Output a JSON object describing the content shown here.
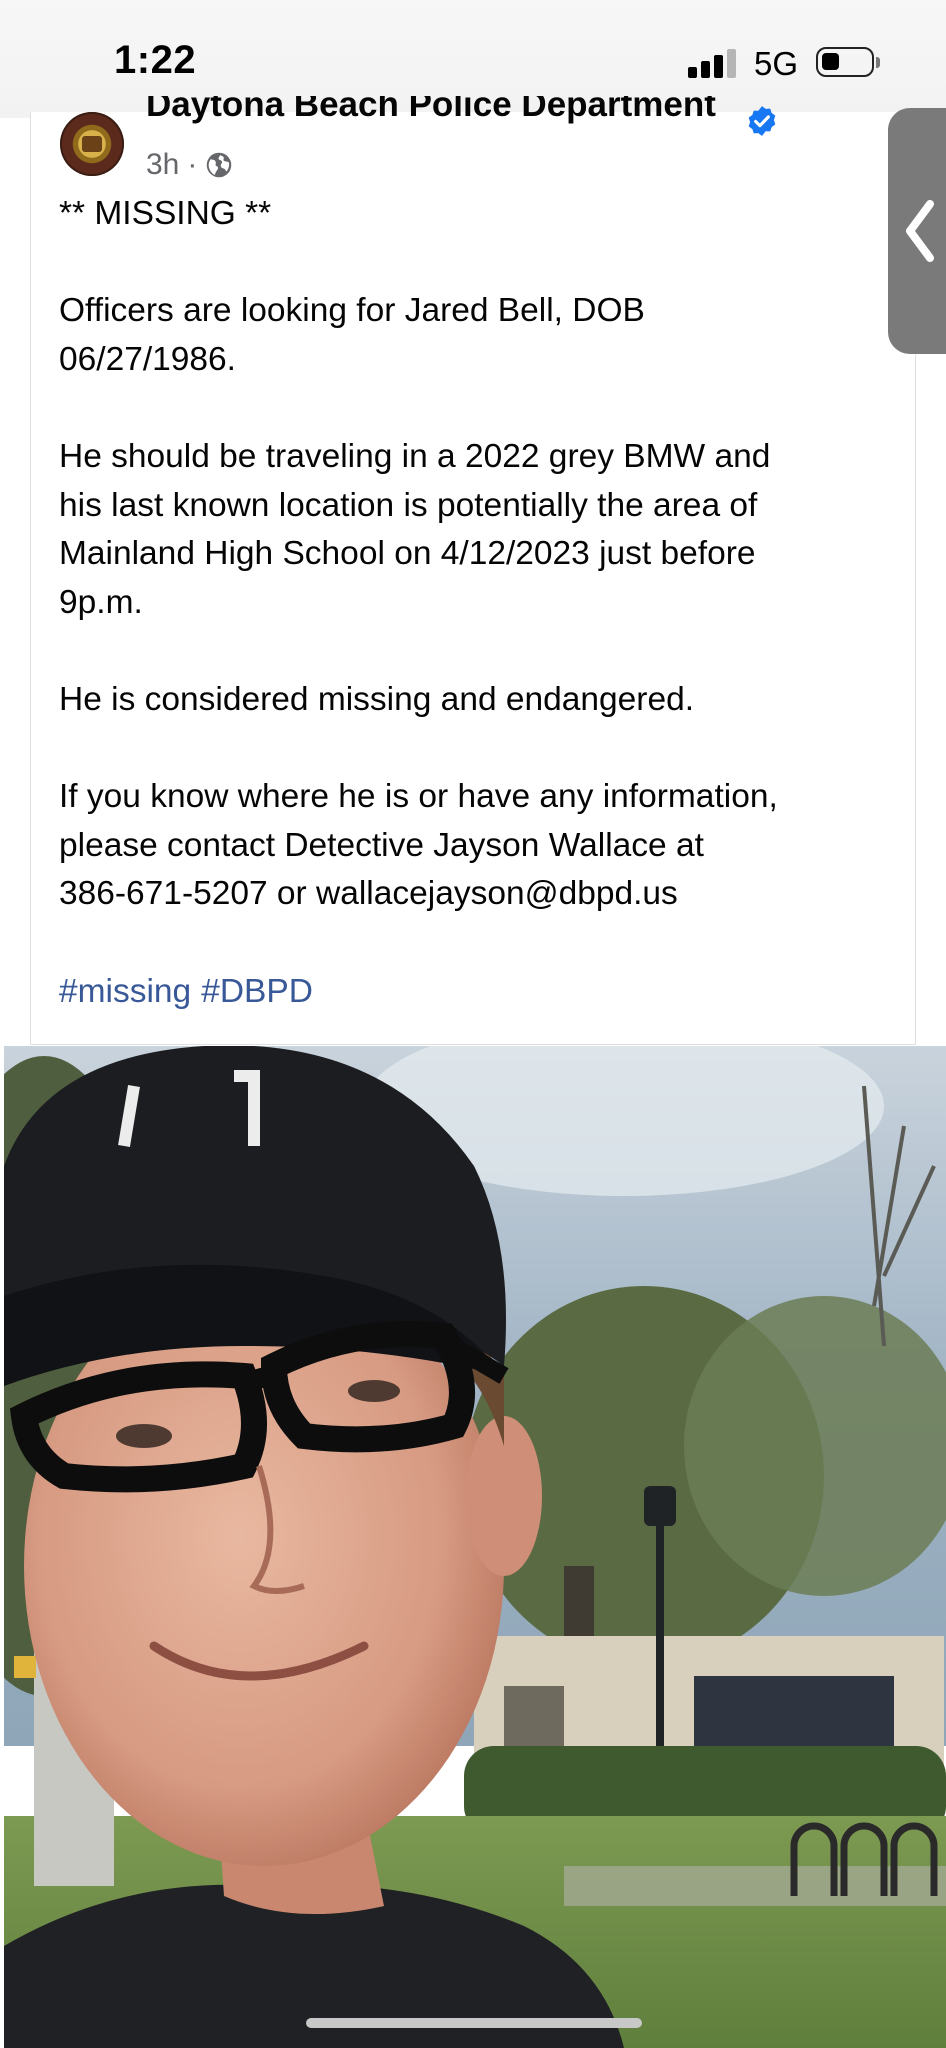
{
  "status_bar": {
    "time": "1:22",
    "network": "5G",
    "signal_bars": 3,
    "battery_level": 0.35
  },
  "post": {
    "page_name": "Daytona Beach Police Department",
    "verified": true,
    "timestamp": "3h",
    "audience_icon": "globe-icon",
    "paragraphs": [
      [
        "** MISSING **"
      ],
      [
        "Officers are looking for Jared Bell, DOB",
        "06/27/1986."
      ],
      [
        "He should be traveling in a 2022 grey BMW and",
        "his last known location is potentially the area of",
        "Mainland High School on 4/12/2023 just before",
        "9p.m."
      ],
      [
        "He is considered missing and endangered."
      ],
      [
        "If you know where he is or have any information,",
        "please contact Detective Jayson Wallace at",
        "386-671-5207 or wallacejayson@dbpd.us"
      ]
    ],
    "hashtags": [
      "#missing",
      "#DBPD"
    ]
  },
  "colors": {
    "link": "#385898",
    "verified": "#1877f2",
    "meta_text": "#65676b",
    "side_tab": "#7a7a7a"
  },
  "side_tab_icon": "chevron-left-icon"
}
